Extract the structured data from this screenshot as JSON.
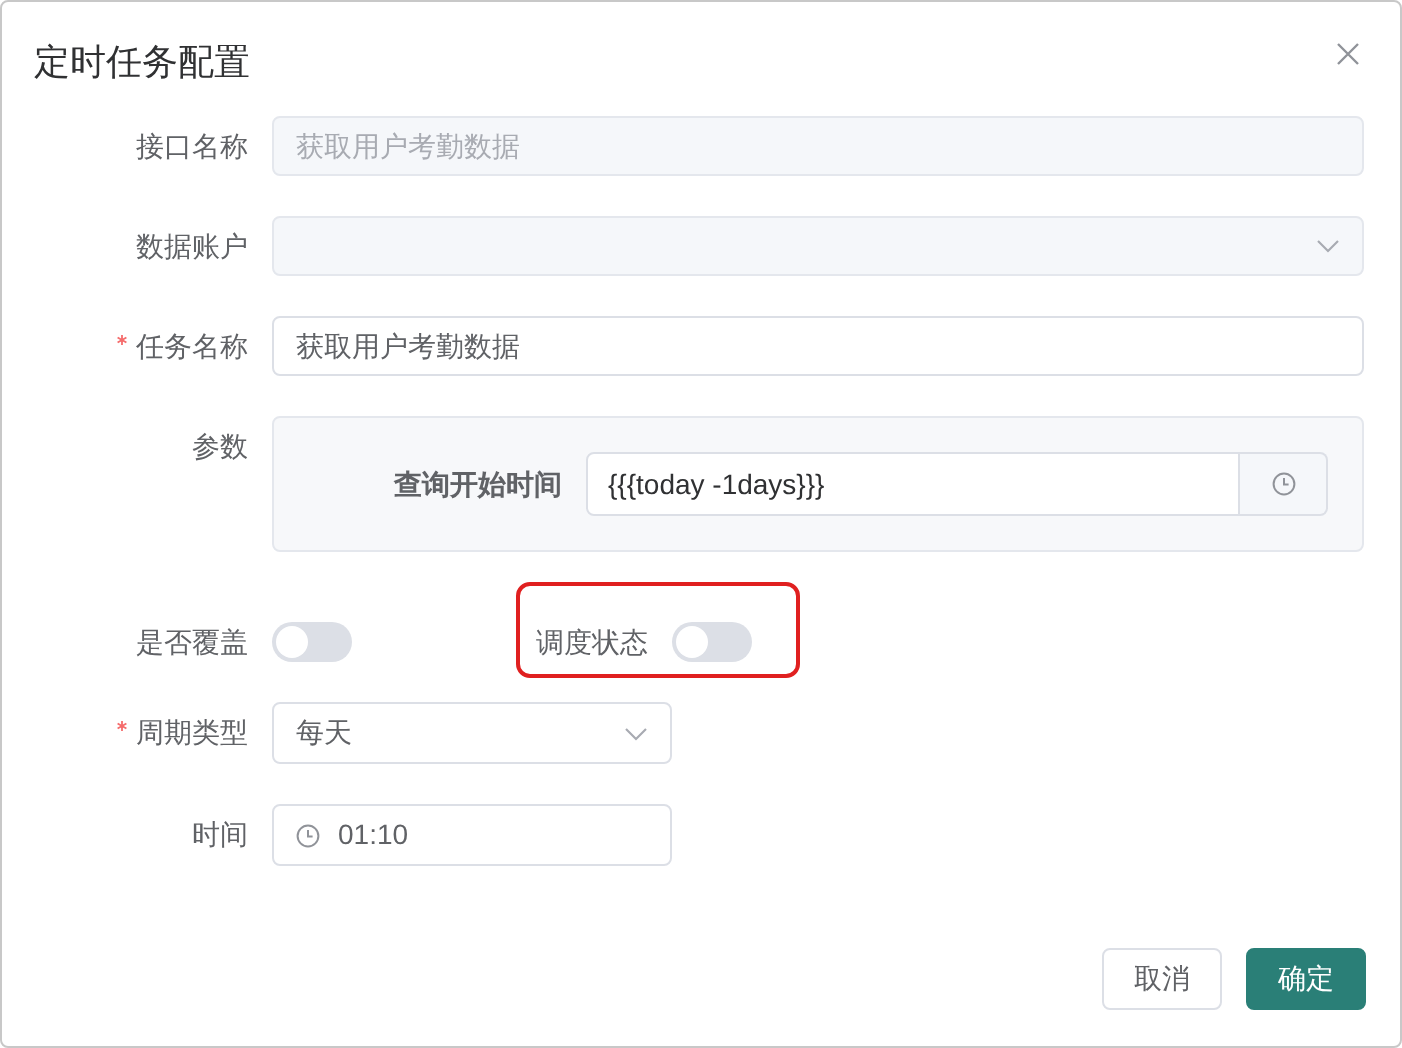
{
  "dialog": {
    "title": "定时任务配置"
  },
  "fields": [
    {
      "kind": "input",
      "label": "接口名称",
      "required": false,
      "disabled": true,
      "value": "获取用户考勤数据"
    },
    {
      "kind": "select",
      "label": "数据账户",
      "required": false,
      "disabled": true
    },
    {
      "kind": "input",
      "label": "任务名称",
      "required": true,
      "disabled": false,
      "value": "获取用户考勤数据"
    },
    {
      "kind": "params",
      "label": "参数",
      "required": false,
      "params": [
        {
          "label": "查询开始时间",
          "value": "{{{today -1days}}}"
        }
      ]
    }
  ],
  "switches": [
    {
      "label": "是否覆盖",
      "on": false,
      "highlighted": false
    },
    {
      "label": "调度状态",
      "on": false,
      "highlighted": true
    }
  ],
  "schedule": [
    {
      "kind": "select",
      "label": "周期类型",
      "required": true,
      "value": "每天"
    },
    {
      "kind": "time",
      "label": "时间",
      "required": false,
      "value": "01:10"
    }
  ],
  "buttons": [
    {
      "label": "取消",
      "primary": false
    },
    {
      "label": "确定",
      "primary": true
    }
  ]
}
